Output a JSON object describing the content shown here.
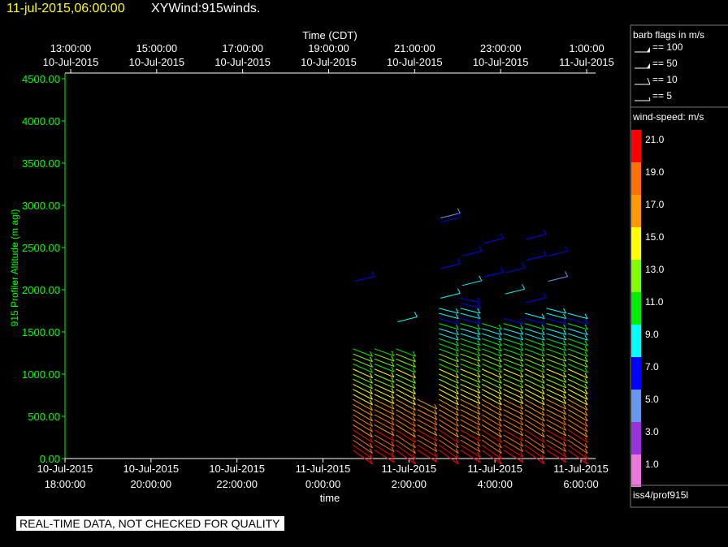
{
  "header": {
    "datetime": "11-jul-2015,06:00:00",
    "product": "XYWind:915winds."
  },
  "legend": {
    "barb_title": "barb flags in m/s",
    "barb_keys": [
      {
        "label": "== 100",
        "kind": "flag100"
      },
      {
        "label": "== 50",
        "kind": "flag50"
      },
      {
        "label": "== 10",
        "kind": "full"
      },
      {
        "label": "== 5",
        "kind": "half"
      }
    ],
    "speed_title": "wind-speed: m/s",
    "color_scale": [
      {
        "label": "21.0",
        "color": "#ff0000"
      },
      {
        "label": "19.0",
        "color": "#ff7000"
      },
      {
        "label": "17.0",
        "color": "#ff9900"
      },
      {
        "label": "15.0",
        "color": "#ffff00"
      },
      {
        "label": "13.0",
        "color": "#80ff00"
      },
      {
        "label": "11.0",
        "color": "#00ee00"
      },
      {
        "label": "9.0",
        "color": "#00ffff"
      },
      {
        "label": "7.0",
        "color": "#0000ff"
      },
      {
        "label": "5.0",
        "color": "#6699ee"
      },
      {
        "label": "3.0",
        "color": "#9933dd"
      },
      {
        "label": "1.0",
        "color": "#ee77dd"
      }
    ],
    "station": "iss4/prof915l"
  },
  "footer": {
    "notice": "REAL-TIME DATA, NOT CHECKED FOR QUALITY"
  },
  "chart_data": {
    "type": "wind-barb",
    "ylabel": "915 Profiler Altitude (m agl)",
    "ylim": [
      0,
      4500
    ],
    "yticks": [
      "0.00",
      "500.00",
      "1000.00",
      "1500.00",
      "2000.00",
      "2500.00",
      "3000.00",
      "3500.00",
      "4000.00",
      "4500.00"
    ],
    "xlabel": "time",
    "x_ticks": [
      {
        "date": "10-Jul-2015",
        "time": "18:00:00"
      },
      {
        "date": "10-Jul-2015",
        "time": "20:00:00"
      },
      {
        "date": "10-Jul-2015",
        "time": "22:00:00"
      },
      {
        "date": "11-Jul-2015",
        "time": "0:00:00"
      },
      {
        "date": "11-Jul-2015",
        "time": "2:00:00"
      },
      {
        "date": "11-Jul-2015",
        "time": "4:00:00"
      },
      {
        "date": "11-Jul-2015",
        "time": "6:00:00"
      }
    ],
    "top_axis": {
      "label": "Time (CDT)",
      "ticks": [
        {
          "time": "13:00:00",
          "date": "10-Jul-2015"
        },
        {
          "time": "15:00:00",
          "date": "10-Jul-2015"
        },
        {
          "time": "17:00:00",
          "date": "10-Jul-2015"
        },
        {
          "time": "19:00:00",
          "date": "10-Jul-2015"
        },
        {
          "time": "21:00:00",
          "date": "10-Jul-2015"
        },
        {
          "time": "23:00:00",
          "date": "10-Jul-2015"
        },
        {
          "time": "1:00:00",
          "date": "11-Jul-2015"
        }
      ]
    },
    "xlim": [
      "2015-07-10 18:00",
      "2015-07-11 06:00"
    ],
    "profile_times": [
      "2015-07-11 01:00",
      "2015-07-11 01:30",
      "2015-07-11 02:00",
      "2015-07-11 02:30",
      "2015-07-11 03:00",
      "2015-07-11 03:30",
      "2015-07-11 04:00",
      "2015-07-11 04:30",
      "2015-07-11 05:00",
      "2015-07-11 05:30",
      "2015-07-11 06:00"
    ],
    "profile_tops_m": [
      1330,
      1350,
      1350,
      750,
      1800,
      1900,
      1640,
      1660,
      1740,
      1820,
      1750
    ],
    "upper_gates": [
      {
        "time": "2015-07-11 01:00",
        "alt": [
          2100
        ],
        "speed": [
          7
        ]
      },
      {
        "time": "2015-07-11 02:00",
        "alt": [
          1620
        ],
        "speed": [
          9
        ]
      },
      {
        "time": "2015-07-11 03:00",
        "alt": [
          2850,
          2800,
          2250,
          1900
        ],
        "speed": [
          5,
          7,
          7,
          9
        ]
      },
      {
        "time": "2015-07-11 03:30",
        "alt": [
          2400,
          2050
        ],
        "speed": [
          7,
          9
        ]
      },
      {
        "time": "2015-07-11 04:00",
        "alt": [
          2550,
          2150
        ],
        "speed": [
          7,
          7
        ]
      },
      {
        "time": "2015-07-11 04:30",
        "alt": [
          2200,
          1950
        ],
        "speed": [
          7,
          9
        ]
      },
      {
        "time": "2015-07-11 05:00",
        "alt": [
          2600,
          2350,
          1850
        ],
        "speed": [
          7,
          7,
          7
        ]
      },
      {
        "time": "2015-07-11 05:30",
        "alt": [
          2400,
          2100
        ],
        "speed": [
          7,
          5
        ]
      }
    ]
  }
}
